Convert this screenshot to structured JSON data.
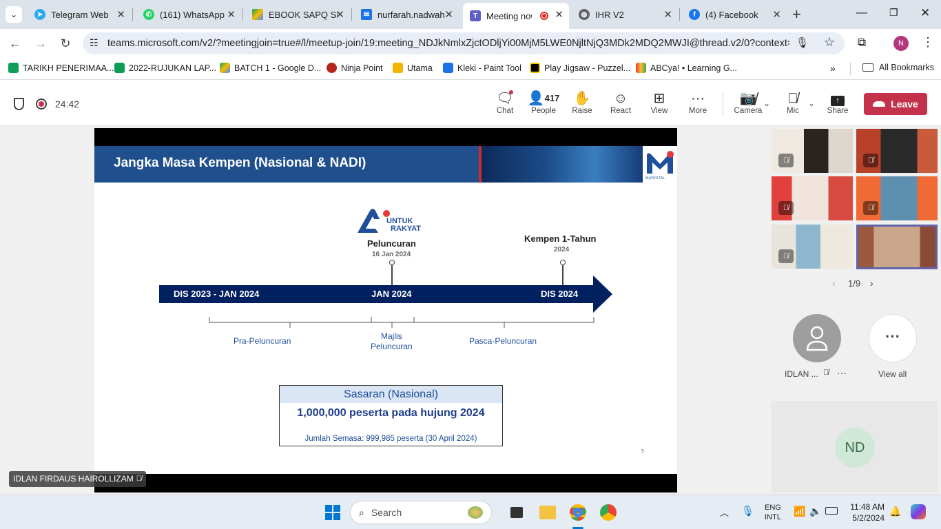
{
  "browser": {
    "tabs": [
      {
        "title": "Telegram Web",
        "icon_color": "#2aabee"
      },
      {
        "title": "(161) WhatsApp",
        "icon_color": "#25d366"
      },
      {
        "title": "EBOOK SAPQ SE",
        "icon_color": "#fbbc04"
      },
      {
        "title": "nurfarah.nadwah",
        "icon_color": "#1a73e8"
      },
      {
        "title": "Meeting now",
        "icon_color": "#5b5fc7"
      },
      {
        "title": "IHR V2",
        "icon_color": "#5f6368"
      },
      {
        "title": "(4) Facebook",
        "icon_color": "#1877f2"
      }
    ],
    "url": "teams.microsoft.com/v2/?meetingjoin=true#/l/meetup-join/19:meeting_NDJkNmlxZjctODljYi00MjM5LWE0NjltNjQ3MDk2MDQ2MWJI@thread.v2/0?context=%7...",
    "profile_initial": "N",
    "bookmarks": [
      "TARIKH PENERIMAA...",
      "2022-RUJUKAN LAP...",
      "BATCH 1 - Google D...",
      "Ninja Point",
      "Utama",
      "Kleki - Paint Tool",
      "Play Jigsaw - Puzzel...",
      "ABCya! • Learning G..."
    ],
    "all_bookmarks": "All Bookmarks"
  },
  "meeting": {
    "timer": "24:42",
    "controls": {
      "chat": "Chat",
      "people": "People",
      "people_count": "417",
      "raise": "Raise",
      "react": "React",
      "view": "View",
      "more": "More",
      "camera": "Camera",
      "mic": "Mic",
      "share": "Share",
      "leave": "Leave"
    },
    "presenter_name": "IDLAN FIRDAUS HAIROLLIZAM",
    "page_indicator": "1/9",
    "participant_short": "IDLAN ...",
    "view_all": "View all",
    "self_initials": "ND"
  },
  "slide": {
    "title": "Jangka Masa Kempen  (Nasional & NADI)",
    "brand_logo_text": "UNTUK RAKYAT",
    "brand_logo_line1": "UNTUK",
    "brand_logo_line2": "RAKYAT",
    "corner_logo_text": "MyDIGITAL",
    "launch_label": "Peluncuran",
    "launch_date": "16 Jan 2024",
    "campaign_label": "Kempen 1-Tahun",
    "campaign_year": "2024",
    "arrow_labels": [
      "DIS 2023 - JAN 2024",
      "JAN 2024",
      "DIS 2024"
    ],
    "phase_labels": {
      "pre": "Pra-Peluncuran",
      "majlis_line1": "Majlis",
      "majlis_line2": "Peluncuran",
      "post": "Pasca-Peluncuran"
    },
    "target_box": {
      "header": "Sasaran (Nasional)",
      "main": "1,000,000 peserta pada hujung 2024",
      "sub": "Jumlah Semasa: 999,985 peserta (30 April 2024)"
    },
    "page_number": "5"
  },
  "taskbar": {
    "search": "Search",
    "lang_line1": "ENG",
    "lang_line2": "INTL",
    "time": "11:48 AM",
    "date": "5/2/2024"
  }
}
